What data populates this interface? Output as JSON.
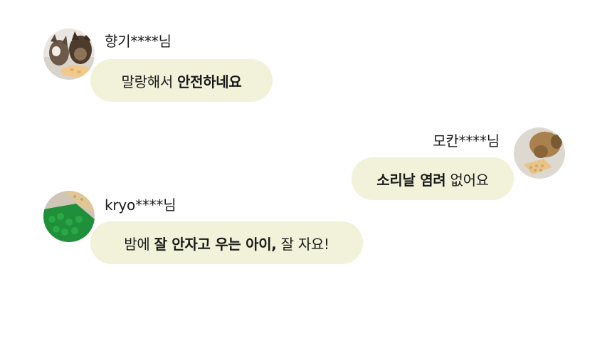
{
  "colors": {
    "bubble": "#f1f2d9",
    "text": "#1a1a1a"
  },
  "messages": [
    {
      "user": "향기****님",
      "avatar": "cats-avatar-icon",
      "parts": [
        {
          "text": "말랑해서 ",
          "bold": false
        },
        {
          "text": "안전하네요",
          "bold": true
        }
      ]
    },
    {
      "user": "모칸****님",
      "avatar": "dog-sniffing-mat-avatar-icon",
      "parts": [
        {
          "text": "소리날 염려",
          "bold": true
        },
        {
          "text": " 없어요",
          "bold": false
        }
      ]
    },
    {
      "user": "kryo****님",
      "avatar": "green-snuffle-mat-avatar-icon",
      "parts": [
        {
          "text": "밤에 ",
          "bold": false
        },
        {
          "text": "잘 안자고 우는 아이,",
          "bold": true
        },
        {
          "text": " 잘 자요!",
          "bold": false
        }
      ]
    }
  ]
}
